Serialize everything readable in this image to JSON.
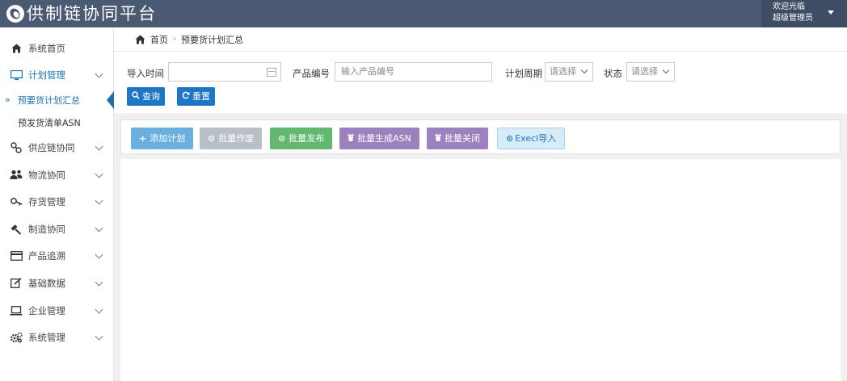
{
  "header": {
    "title": "供制链协同平台",
    "user_greeting": "欢迎光临",
    "user_role": "超级管理员"
  },
  "sidebar": {
    "items": [
      {
        "label": "系统首页",
        "icon": "home-icon",
        "has_chevron": false
      },
      {
        "label": "计划管理",
        "icon": "monitor-icon",
        "has_chevron": true,
        "active_color": "#1a73b8"
      },
      {
        "label": "供应链协同",
        "icon": "link-icon",
        "has_chevron": true
      },
      {
        "label": "物流协同",
        "icon": "users-icon",
        "has_chevron": true
      },
      {
        "label": "存货管理",
        "icon": "key-icon",
        "has_chevron": true
      },
      {
        "label": "制造协同",
        "icon": "hammer-icon",
        "has_chevron": true
      },
      {
        "label": "产品追溯",
        "icon": "card-icon",
        "has_chevron": true
      },
      {
        "label": "基础数据",
        "icon": "edit-icon",
        "has_chevron": true
      },
      {
        "label": "企业管理",
        "icon": "laptop-icon",
        "has_chevron": true
      },
      {
        "label": "系统管理",
        "icon": "gears-icon",
        "has_chevron": true
      }
    ],
    "subitems": [
      {
        "label": "预要货计划汇总",
        "active": true
      },
      {
        "label": "预发货清单ASN",
        "active": false
      }
    ]
  },
  "breadcrumb": {
    "home": "首页",
    "current": "预要货计划汇总"
  },
  "filters": {
    "import_time_label": "导入时间",
    "import_time_value": "",
    "product_code_label": "产品编号",
    "product_code_placeholder": "输入产品编号",
    "plan_period_label": "计划周期",
    "plan_period_value": "请选择",
    "status_label": "状态",
    "status_value": "请选择",
    "query_label": "查询",
    "reset_label": "重置"
  },
  "actions": [
    {
      "label": "添加计划",
      "icon": "plus-icon",
      "color": "#6ab0de"
    },
    {
      "label": "批量作废",
      "icon": "circle-x-icon",
      "color": "#b8c0c6"
    },
    {
      "label": "批量发布",
      "icon": "circle-check-icon",
      "color": "#62b86f"
    },
    {
      "label": "批量生成ASN",
      "icon": "trash-icon",
      "color": "#9b82bf"
    },
    {
      "label": "批量关闭",
      "icon": "trash-icon",
      "color": "#9b82bf"
    },
    {
      "label": "Execl导入",
      "icon": "upload-icon",
      "color": "#d8ecf8"
    }
  ],
  "colors": {
    "header_bg": "#4a5a72",
    "primary_blue": "#1f76c4",
    "content_bg": "#f0f0f0"
  }
}
